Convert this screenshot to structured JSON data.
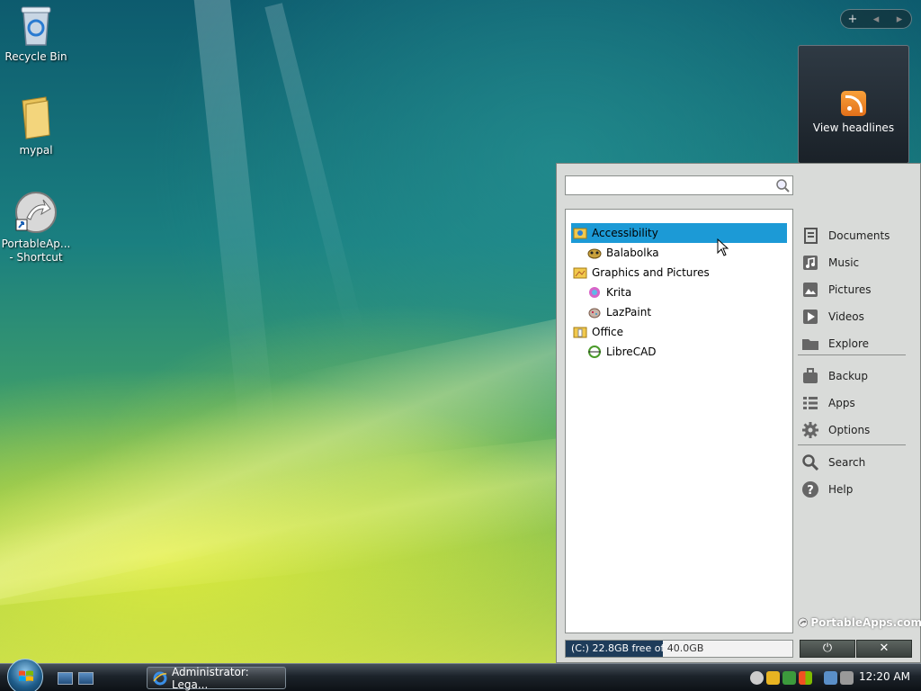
{
  "desktop": {
    "icons": [
      {
        "label": "Recycle Bin"
      },
      {
        "label": "mypal"
      },
      {
        "label": "PortableAp...",
        "label2": "- Shortcut"
      }
    ]
  },
  "gadget": {
    "nav_add": "+",
    "nav_prev": "◂",
    "nav_next": "▸",
    "headlines_label": "View headlines"
  },
  "portableapps": {
    "search": {
      "value": "",
      "placeholder": ""
    },
    "tree": [
      {
        "type": "category",
        "label": "Accessibility",
        "selected": true
      },
      {
        "type": "app",
        "label": "Balabolka"
      },
      {
        "type": "category",
        "label": "Graphics and Pictures"
      },
      {
        "type": "app",
        "label": "Krita"
      },
      {
        "type": "app",
        "label": "LazPaint"
      },
      {
        "type": "category",
        "label": "Office"
      },
      {
        "type": "app",
        "label": "LibreCAD"
      }
    ],
    "drive_status": "(C:) 22.8GB free of 40.0GB",
    "drive_used_fraction": 0.43,
    "side": {
      "documents": "Documents",
      "music": "Music",
      "pictures": "Pictures",
      "videos": "Videos",
      "explore": "Explore",
      "backup": "Backup",
      "apps": "Apps",
      "options": "Options",
      "search": "Search",
      "help": "Help"
    },
    "brand": "PortableApps.com",
    "power_label": "⏻",
    "close_label": "✕"
  },
  "taskbar": {
    "task_label": "Administrator: Lega...",
    "clock": "12:20 AM"
  },
  "colors": {
    "selection": "#1c9ad6",
    "menu_bg": "#d9dbd9",
    "drive_fill": "#1e3c5a"
  }
}
